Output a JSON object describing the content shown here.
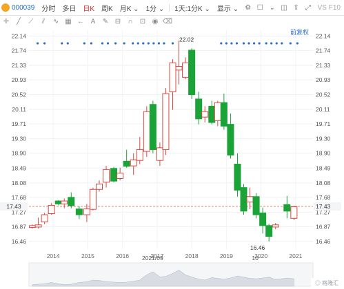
{
  "toolbar": {
    "code": "000039",
    "tabs": [
      "分时",
      "多日",
      "日K",
      "周K",
      "月K",
      "1分",
      "1天:1分K",
      "显示"
    ],
    "active_tab": "日K",
    "right_label": "VS F10"
  },
  "drawing_tools": [
    "crosshair-icon",
    "line-icon",
    "trend-icon",
    "parallel-icon",
    "wave-icon",
    "grid-icon",
    "arrow-icon",
    "text-icon",
    "pen-icon",
    "ruler-icon",
    "magnet-icon",
    "lock-icon",
    "eye-icon",
    "trash-icon"
  ],
  "colors": {
    "up": "#e0443c",
    "down": "#1aa336",
    "price_line": "#e8837a"
  },
  "chart_data": {
    "type": "candlestick",
    "adjustment_label": "前复权",
    "y_ticks": [
      "22.14",
      "21.74",
      "21.33",
      "20.93",
      "20.52",
      "20.11",
      "19.71",
      "19.30",
      "18.90",
      "18.49",
      "18.08",
      "17.68",
      "17.27",
      "16.87",
      "16.46"
    ],
    "ylim": [
      16.25,
      22.3
    ],
    "current_price": "17.43",
    "max_label": "22.02",
    "min_label": "16.46",
    "x_ticks": [
      "2014",
      "2015",
      "2016",
      "2017",
      "2018",
      "2019",
      "2020",
      "2021"
    ],
    "x_range": [
      2013.6,
      2021.8
    ],
    "date_markers": [
      "2021/09",
      "10"
    ],
    "candles": [
      {
        "t": 2013.7,
        "o": 16.85,
        "h": 16.93,
        "l": 16.82,
        "c": 16.9
      },
      {
        "t": 2013.87,
        "o": 16.86,
        "h": 17.12,
        "l": 16.82,
        "c": 16.92
      },
      {
        "t": 2014.05,
        "o": 17.0,
        "h": 17.25,
        "l": 16.94,
        "c": 17.2
      },
      {
        "t": 2014.25,
        "o": 17.23,
        "h": 17.52,
        "l": 17.2,
        "c": 17.46
      },
      {
        "t": 2014.45,
        "o": 17.58,
        "h": 17.6,
        "l": 17.46,
        "c": 17.5
      },
      {
        "t": 2014.62,
        "o": 17.5,
        "h": 17.65,
        "l": 17.38,
        "c": 17.58
      },
      {
        "t": 2014.82,
        "o": 17.68,
        "h": 17.82,
        "l": 17.38,
        "c": 17.45
      },
      {
        "t": 2015.05,
        "o": 17.36,
        "h": 17.44,
        "l": 17.08,
        "c": 17.2
      },
      {
        "t": 2015.27,
        "o": 17.2,
        "h": 17.5,
        "l": 17.0,
        "c": 17.36
      },
      {
        "t": 2015.45,
        "o": 17.35,
        "h": 17.95,
        "l": 17.32,
        "c": 17.9
      },
      {
        "t": 2015.63,
        "o": 17.9,
        "h": 18.15,
        "l": 17.84,
        "c": 18.05
      },
      {
        "t": 2015.83,
        "o": 18.1,
        "h": 18.55,
        "l": 17.95,
        "c": 18.45
      },
      {
        "t": 2016.05,
        "o": 18.48,
        "h": 18.52,
        "l": 18.1,
        "c": 18.13
      },
      {
        "t": 2016.23,
        "o": 18.2,
        "h": 18.5,
        "l": 18.15,
        "c": 18.35
      },
      {
        "t": 2016.42,
        "o": 18.68,
        "h": 19.0,
        "l": 18.5,
        "c": 18.54
      },
      {
        "t": 2016.62,
        "o": 18.55,
        "h": 18.9,
        "l": 18.3,
        "c": 18.72
      },
      {
        "t": 2016.8,
        "o": 18.7,
        "h": 19.35,
        "l": 18.6,
        "c": 19.0
      },
      {
        "t": 2017.0,
        "o": 18.95,
        "h": 20.2,
        "l": 18.8,
        "c": 20.05
      },
      {
        "t": 2017.18,
        "o": 20.25,
        "h": 20.35,
        "l": 18.9,
        "c": 19.0
      },
      {
        "t": 2017.38,
        "o": 18.7,
        "h": 19.2,
        "l": 18.55,
        "c": 19.05
      },
      {
        "t": 2017.55,
        "o": 19.0,
        "h": 20.7,
        "l": 18.85,
        "c": 20.55
      },
      {
        "t": 2017.75,
        "o": 20.6,
        "h": 21.5,
        "l": 20.1,
        "c": 21.4
      },
      {
        "t": 2017.93,
        "o": 21.2,
        "h": 22.02,
        "l": 20.8,
        "c": 21.3
      },
      {
        "t": 2018.12,
        "o": 21.0,
        "h": 21.55,
        "l": 20.95,
        "c": 21.4
      },
      {
        "t": 2018.3,
        "o": 21.75,
        "h": 21.8,
        "l": 20.4,
        "c": 20.52
      },
      {
        "t": 2018.5,
        "o": 20.4,
        "h": 20.6,
        "l": 19.7,
        "c": 19.85
      },
      {
        "t": 2018.68,
        "o": 19.9,
        "h": 20.2,
        "l": 19.75,
        "c": 20.05
      },
      {
        "t": 2018.88,
        "o": 20.2,
        "h": 20.35,
        "l": 19.7,
        "c": 19.75
      },
      {
        "t": 2019.05,
        "o": 19.8,
        "h": 20.35,
        "l": 19.65,
        "c": 20.3
      },
      {
        "t": 2019.23,
        "o": 20.3,
        "h": 20.55,
        "l": 19.55,
        "c": 19.65
      },
      {
        "t": 2019.42,
        "o": 19.7,
        "h": 20.0,
        "l": 18.75,
        "c": 18.85
      },
      {
        "t": 2019.62,
        "o": 18.6,
        "h": 18.9,
        "l": 17.7,
        "c": 17.88
      },
      {
        "t": 2019.8,
        "o": 17.95,
        "h": 18.05,
        "l": 17.2,
        "c": 17.3
      },
      {
        "t": 2019.98,
        "o": 17.55,
        "h": 17.95,
        "l": 17.35,
        "c": 17.7
      },
      {
        "t": 2020.16,
        "o": 17.7,
        "h": 17.8,
        "l": 17.1,
        "c": 17.2
      },
      {
        "t": 2020.35,
        "o": 17.25,
        "h": 17.4,
        "l": 16.68,
        "c": 16.9
      },
      {
        "t": 2020.53,
        "o": 16.9,
        "h": 16.95,
        "l": 16.46,
        "c": 16.6
      },
      {
        "t": 2020.72,
        "o": 16.86,
        "h": 16.97,
        "l": 16.8,
        "c": 16.92
      },
      {
        "t": 2021.05,
        "o": 17.48,
        "h": 17.72,
        "l": 17.1,
        "c": 17.3
      },
      {
        "t": 2021.25,
        "o": 17.1,
        "h": 17.45,
        "l": 17.05,
        "c": 17.42
      }
    ],
    "volume": [
      0.08,
      0.1,
      0.12,
      0.18,
      0.12,
      0.08,
      0.1,
      0.18,
      0.22,
      0.3,
      0.28,
      0.22,
      0.2,
      0.18,
      0.2,
      0.24,
      0.3,
      0.55,
      0.7,
      0.45,
      0.48,
      0.62,
      0.78,
      0.55,
      0.45,
      0.35,
      0.3,
      0.42,
      0.38,
      0.34,
      0.4,
      0.5,
      0.44,
      0.38,
      0.36,
      0.4,
      0.44,
      0.32,
      0.4,
      0.36
    ]
  }
}
